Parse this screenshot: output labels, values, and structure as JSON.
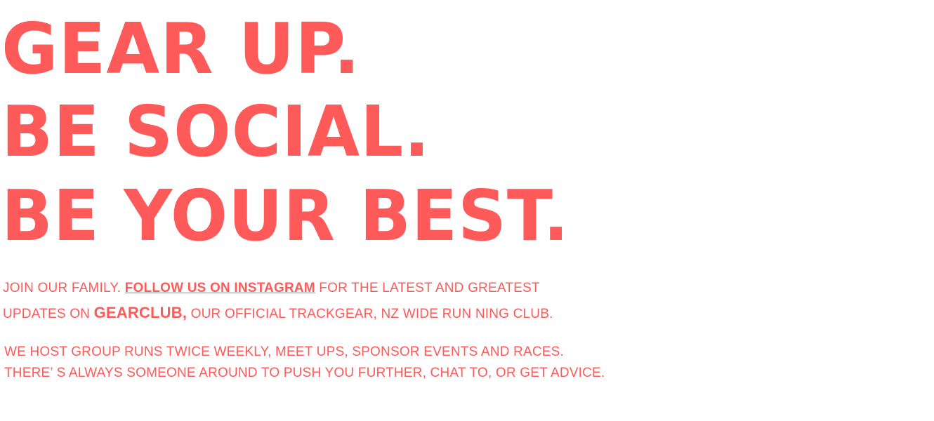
{
  "headline": {
    "line1": "GEAR UP.",
    "line2": "BE SOCIAL.",
    "line3": "BE YOUR BEST."
  },
  "intro": {
    "prefix": "JOIN OUR FAMILY. ",
    "link_label": "FOLLOW US ON INSTAGRAM",
    "after_link": " FOR THE LATEST AND GREATEST",
    "line2_prefix": "UPDATES ON ",
    "brand": "GEARCLUB,",
    "line2_suffix": " OUR OFFICIAL TRACKGEAR, NZ WIDE RUN NING CLUB."
  },
  "details": {
    "line1": "WE HOST GROUP RUNS TWICE WEEKLY, MEET UPS, SPONSOR EVENTS AND RACES.",
    "line2": "THERE’ S ALWAYS SOMEONE AROUND TO PUSH YOU FURTHER, CHAT TO, OR GET ADVICE."
  },
  "colors": {
    "accent": "#ff5a5a",
    "background": "#ffffff"
  }
}
